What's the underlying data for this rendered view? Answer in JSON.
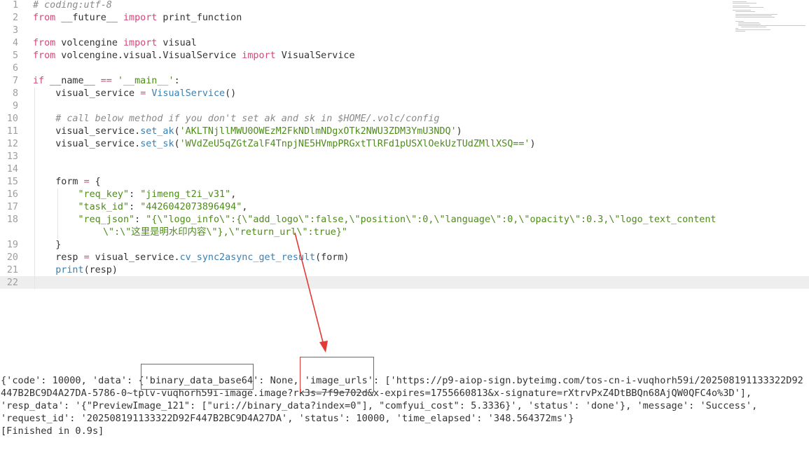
{
  "editor": {
    "line_numbers": [
      "1",
      "2",
      "3",
      "4",
      "5",
      "6",
      "7",
      "8",
      "9",
      "10",
      "11",
      "12",
      "13",
      "14",
      "15",
      "16",
      "17",
      "18",
      "19",
      "20",
      "21",
      "22"
    ],
    "lines": {
      "l1": {
        "comment": "# coding:utf-8"
      },
      "l2": {
        "kw1": "from",
        "t1": " __future__ ",
        "kw2": "import",
        "t2": " print_function"
      },
      "l4": {
        "kw1": "from",
        "t1": " volcengine ",
        "kw2": "import",
        "t2": " visual"
      },
      "l5": {
        "kw1": "from",
        "t1": " volcengine.visual.VisualService ",
        "kw2": "import",
        "t2": " VisualService"
      },
      "l7": {
        "kw1": "if",
        "t1": " __name__ ",
        "op": "==",
        "t2": " ",
        "str": "'__main__'",
        "t3": ":"
      },
      "l8": {
        "t1": "    visual_service ",
        "op": "=",
        "t2": " ",
        "fn": "VisualService",
        "t3": "()"
      },
      "l10": {
        "comment": "    # call below method if you don't set ak and sk in $HOME/.volc/config"
      },
      "l11": {
        "t1": "    visual_service.",
        "fn": "set_ak",
        "t2": "(",
        "str": "'AKLTNjllMWU0OWEzM2FkNDlmNDgxOTk2NWU3ZDM3YmU3NDQ'",
        "t3": ")"
      },
      "l12": {
        "t1": "    visual_service.",
        "fn": "set_sk",
        "t2": "(",
        "str": "'WVdZeU5qZGtZalF4TnpjNE5HVmpPRGxtTlRFd1pUSXlOekUzTUdZMllXSQ=='",
        "t3": ")"
      },
      "l15": {
        "t1": "    form ",
        "op": "=",
        "t2": " {"
      },
      "l16": {
        "t1": "        ",
        "str1": "\"req_key\"",
        "t2": ": ",
        "str2": "\"jimeng_t2i_v31\"",
        "t3": ","
      },
      "l17": {
        "t1": "        ",
        "str1": "\"task_id\"",
        "t2": ": ",
        "str2": "\"4426042073896494\"",
        "t3": ","
      },
      "l18": {
        "t1": "        ",
        "str1": "\"req_json\"",
        "t2": ": ",
        "str2": "\"{\\\"logo_info\\\":{\\\"add_logo\\\":false,\\\"position\\\":0,\\\"language\\\":0,\\\"opacity\\\":0.3,\\\"logo_text_content"
      },
      "l18b": {
        "str": "\\\":\\\"这里是明水印内容\\\"},\\\"return_url\\\":true}\""
      },
      "l19": {
        "t1": "    }"
      },
      "l20": {
        "t1": "    resp ",
        "op": "=",
        "t2": " visual_service.",
        "fn": "cv_sync2async_get_result",
        "t3": "(form)"
      },
      "l21": {
        "t1": "    ",
        "fn": "print",
        "t2": "(resp)"
      }
    }
  },
  "output": {
    "line1a": "{'code': 10000, 'data': {",
    "line1_key1": "'binary_data_base64'",
    "line1b": ": None, ",
    "line1_key2": "'image_urls'",
    "line1c": ": ['https://p9-aiop-sign.byteimg.com/tos-cn-i-vuqhorh59i/202508191133322D92",
    "line2": "447B2BC9D4A27DA-5786-0~tplv-vuqhorh59i-image.image?rk3s=7f9e702d&x-expires=1755660813&x-signature=rXtrvPxZ4DtBBQn68AjQW0QFC4o%3D'],",
    "line3": "'resp_data': '{\"PreviewImage_121\": [\"uri://binary_data?index=0\"], \"comfyui_cost\": 5.3336}', 'status': 'done'}, 'message': 'Success',",
    "line4": "'request_id': '202508191133322D92F447B2BC9D4A27DA', 'status': 10000, 'time_elapsed': '348.564372ms'}",
    "line5": "[Finished in 0.9s]"
  },
  "colors": {
    "keyword": "#d4477a",
    "string": "#4e8b1c",
    "comment": "#8a8a8a",
    "function": "#3c7fb0",
    "annotation": "#e53935"
  }
}
